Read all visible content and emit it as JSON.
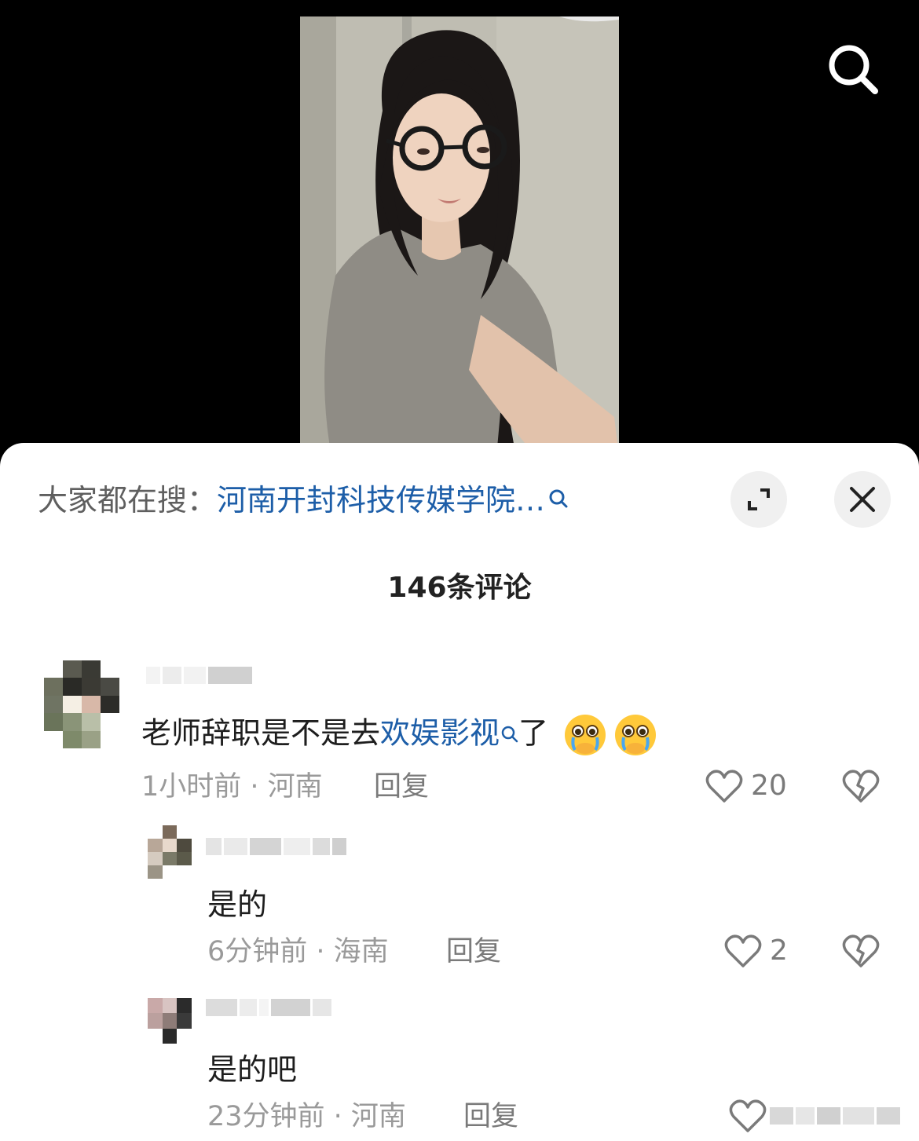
{
  "hot_search": {
    "prefix": "大家都在搜：",
    "term": "河南开封科技传媒学院…"
  },
  "comment_count": "146条评论",
  "comments": [
    {
      "text_before": "老师辞职是不是去",
      "keyword": "欢娱影视",
      "text_after": "了",
      "emoji": "crying-face-emoji",
      "time_location": "1小时前 · 河南",
      "reply_label": "回复",
      "likes": "20"
    }
  ],
  "replies": [
    {
      "text": "是的",
      "time_location": "6分钟前 · 海南",
      "reply_label": "回复",
      "likes": "2"
    },
    {
      "text": "是的吧",
      "time_location": "23分钟前 · 河南",
      "reply_label": "回复"
    }
  ],
  "colors": {
    "link_blue": "#1d5ea8",
    "meta_gray": "#9a9a9a",
    "sheet_bg": "#ffffff",
    "video_bg": "#000000"
  },
  "icons": [
    "search-icon",
    "expand-icon",
    "close-icon",
    "heart-icon",
    "broken-heart-icon",
    "crying-face-emoji"
  ]
}
